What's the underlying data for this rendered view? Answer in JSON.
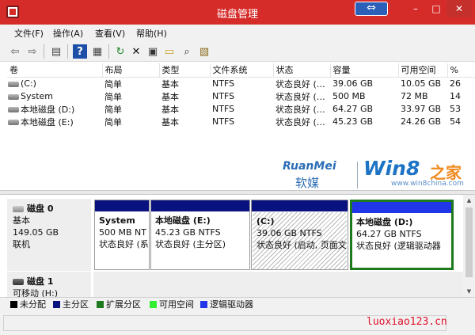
{
  "window": {
    "title": "磁盘管理",
    "min_glyph": "–",
    "max_glyph": "□",
    "close_glyph": "✕",
    "capture_glyph": "⇔"
  },
  "menu": [
    "文件(F)",
    "操作(A)",
    "查看(V)",
    "帮助(H)"
  ],
  "toolbar": [
    {
      "icon": "back-arrow-icon",
      "glyph": "⇦"
    },
    {
      "icon": "forward-arrow-icon",
      "glyph": "⇨"
    },
    {
      "icon": "console-tree-icon",
      "glyph": "▤"
    },
    {
      "icon": "help-icon",
      "glyph": "?"
    },
    {
      "icon": "properties-icon",
      "glyph": "▦"
    },
    {
      "icon": "refresh-icon",
      "glyph": "↻"
    },
    {
      "icon": "delete-icon",
      "glyph": "✕"
    },
    {
      "icon": "properties-sheet-icon",
      "glyph": "▣"
    },
    {
      "icon": "open-icon",
      "glyph": "▭"
    },
    {
      "icon": "explore-icon",
      "glyph": "⌕"
    },
    {
      "icon": "help-topics-icon",
      "glyph": "▧"
    }
  ],
  "volume_table": {
    "headers": [
      "卷",
      "布局",
      "类型",
      "文件系统",
      "状态",
      "容量",
      "可用空间",
      "%"
    ],
    "rows": [
      [
        "(C:)",
        "简单",
        "基本",
        "NTFS",
        "状态良好 (…",
        "39.06 GB",
        "10.05 GB",
        "26"
      ],
      [
        "System",
        "简单",
        "基本",
        "NTFS",
        "状态良好 (…",
        "500 MB",
        "72 MB",
        "14"
      ],
      [
        "本地磁盘 (D:)",
        "简单",
        "基本",
        "NTFS",
        "状态良好 (…",
        "64.27 GB",
        "33.97 GB",
        "53"
      ],
      [
        "本地磁盘 (E:)",
        "简单",
        "基本",
        "NTFS",
        "状态良好 (…",
        "45.23 GB",
        "24.26 GB",
        "54"
      ]
    ]
  },
  "watermark": {
    "brand": "RuanMei",
    "brand_cn": "软媒",
    "win8": "Win8",
    "zhijia": "之家",
    "url": "www.win8china.com"
  },
  "disks": [
    {
      "name": "磁盘 0",
      "type": "基本",
      "size": "149.05 GB",
      "status": "联机",
      "partitions": [
        {
          "name": "System",
          "size": "500 MB NT",
          "status": "状态良好 (系",
          "kind": "primary"
        },
        {
          "name": "本地磁盘  (E:)",
          "size": "45.23 GB NTFS",
          "status": "状态良好 (主分区)",
          "kind": "primary"
        },
        {
          "name": "(C:)",
          "size": "39.06 GB NTFS",
          "status": "状态良好 (启动, 页面文",
          "kind": "primary"
        },
        {
          "name": "本地磁盘  (D:)",
          "size": "64.27 GB NTFS",
          "status": "状态良好 (逻辑驱动器",
          "kind": "logical"
        }
      ]
    },
    {
      "name": "磁盘 1",
      "type": "可移动 (H:)"
    }
  ],
  "legend": [
    {
      "label": "未分配",
      "color": "#000000"
    },
    {
      "label": "主分区",
      "color": "#0a1280"
    },
    {
      "label": "扩展分区",
      "color": "#1d7a1d"
    },
    {
      "label": "可用空间",
      "color": "#33ee33"
    },
    {
      "label": "逻辑驱动器",
      "color": "#2136e8"
    }
  ],
  "site_mark": "luoxiao123.cn",
  "colors": {
    "titlebar": "#d52b29",
    "primary": "#0a1280",
    "logical": "#2136e8",
    "selected_border": "#1d7a1d"
  }
}
